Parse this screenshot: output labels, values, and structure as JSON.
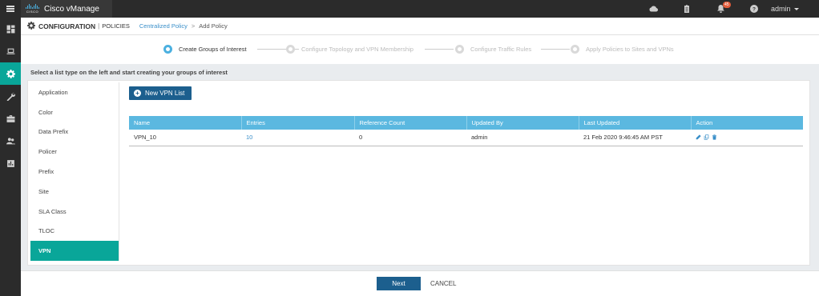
{
  "app": {
    "title": "Cisco vManage",
    "logo_word": "CISCO"
  },
  "topbar": {
    "notification_count": "45",
    "user": "admin"
  },
  "header": {
    "section": "CONFIGURATION",
    "separator": "|",
    "subsection": "POLICIES",
    "breadcrumb_link": "Centralized Policy",
    "breadcrumb_arrow": ">",
    "breadcrumb_current": "Add Policy"
  },
  "steps": [
    {
      "label": "Create Groups of Interest",
      "active": true
    },
    {
      "label": "Configure Topology and VPN Membership",
      "active": false
    },
    {
      "label": "Configure Traffic Rules",
      "active": false
    },
    {
      "label": "Apply Policies to Sites and VPNs",
      "active": false
    }
  ],
  "instruction": "Select a list type on the left and start creating your groups of interest",
  "list_types": [
    {
      "label": "Application"
    },
    {
      "label": "Color"
    },
    {
      "label": "Data Prefix"
    },
    {
      "label": "Policer"
    },
    {
      "label": "Prefix"
    },
    {
      "label": "Site"
    },
    {
      "label": "SLA Class"
    },
    {
      "label": "TLOC"
    },
    {
      "label": "VPN",
      "active": true
    }
  ],
  "new_button": "New VPN List",
  "table": {
    "headers": [
      "Name",
      "Entries",
      "Reference Count",
      "Updated By",
      "Last Updated",
      "Action"
    ],
    "rows": [
      {
        "name": "VPN_10",
        "entries": "10",
        "reference_count": "0",
        "updated_by": "admin",
        "last_updated": "21 Feb 2020 9:46:45 AM PST"
      }
    ]
  },
  "footer": {
    "next": "Next",
    "cancel": "CANCEL"
  },
  "colors": {
    "accent_teal": "#09a699",
    "primary_blue": "#1c5f8e",
    "table_header": "#5bb8e0",
    "link_blue": "#3a8fc9"
  },
  "icons": {
    "rail": [
      "dashboard-icon",
      "monitor-icon",
      "configuration-gear-icon",
      "tools-wrench-icon",
      "maintenance-toolbox-icon",
      "administration-users-icon",
      "analytics-chart-icon"
    ],
    "topbar": [
      "cloud-icon",
      "task-clipboard-icon",
      "bell-icon",
      "help-icon"
    ],
    "actions": [
      "edit-pencil-icon",
      "copy-icon",
      "delete-trash-icon"
    ]
  }
}
